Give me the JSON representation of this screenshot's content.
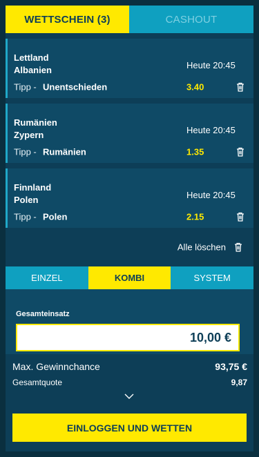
{
  "tabs": {
    "betslip_label": "WETTSCHEIN (3)",
    "cashout_label": "CASHOUT"
  },
  "bets": [
    {
      "team1": "Lettland",
      "team2": "Albanien",
      "time": "Heute 20:45",
      "tipp_label": "Tipp -",
      "tipp_value": "Unentschieden",
      "odds": "3.40"
    },
    {
      "team1": "Rumänien",
      "team2": "Zypern",
      "time": "Heute 20:45",
      "tipp_label": "Tipp -",
      "tipp_value": "Rumänien",
      "odds": "1.35"
    },
    {
      "team1": "Finnland",
      "team2": "Polen",
      "time": "Heute 20:45",
      "tipp_label": "Tipp -",
      "tipp_value": "Polen",
      "odds": "2.15"
    }
  ],
  "clear_all_label": "Alle löschen",
  "mode_tabs": {
    "einzel": "EINZEL",
    "kombi": "KOMBI",
    "system": "SYSTEM"
  },
  "stake": {
    "label": "Gesamteinsatz",
    "value": "10,00 €"
  },
  "summary": {
    "max_label": "Max. Gewinnchance",
    "max_value": "93,75 €",
    "quote_label": "Gesamtquote",
    "quote_value": "9,87"
  },
  "login_button_label": "EINLOGGEN UND WETTEN",
  "colors": {
    "accent_yellow": "#ffe900",
    "accent_cyan": "#0fa0c0",
    "panel_bg": "#0d3e57"
  }
}
